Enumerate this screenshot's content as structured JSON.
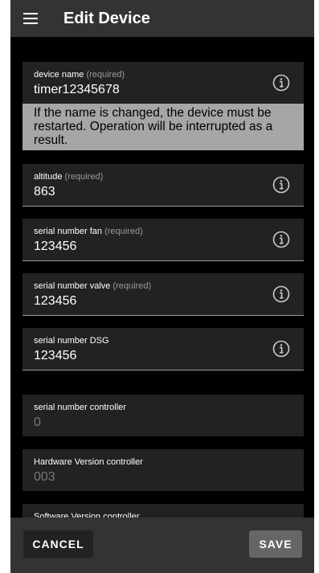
{
  "appbar": {
    "title": "Edit Device",
    "menu_icon": "hamburger-menu-icon"
  },
  "fields": {
    "device_name": {
      "label": "device name",
      "required": "(required)",
      "value": "timer12345678"
    },
    "warning": "If the name is changed, the device must be restarted. Operation will be interrupted as a result.",
    "altitude": {
      "label": "altitude",
      "required": "(required)",
      "value": "863"
    },
    "serial_fan": {
      "label": "serial number fan",
      "required": "(required)",
      "value": "123456"
    },
    "serial_valve": {
      "label": "serial number valve",
      "required": "(required)",
      "value": "123456"
    },
    "serial_dsg": {
      "label": "serial number DSG",
      "value": "123456"
    },
    "serial_controller": {
      "label": "serial number controller",
      "value": "0"
    },
    "hw_controller": {
      "label": "Hardware Version controller",
      "value": "003"
    },
    "sw_controller": {
      "label": "Software Version controller"
    }
  },
  "actions": {
    "cancel": "CANCEL",
    "save": "SAVE"
  },
  "icons": {
    "info": "info-icon"
  },
  "colors": {
    "background": "#000000",
    "appbar": "#333333",
    "field": "#222222",
    "warning": "#a6a6a6",
    "save_button": "#666666"
  }
}
